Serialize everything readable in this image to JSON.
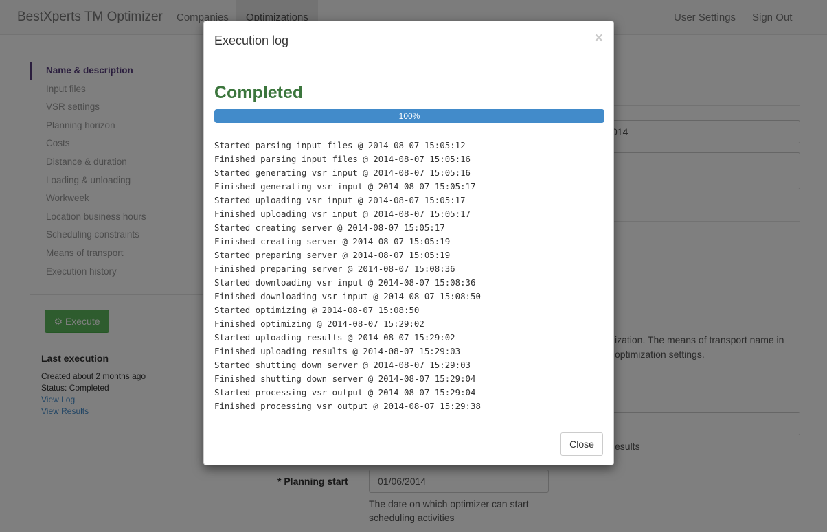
{
  "navbar": {
    "brand": "BestXperts TM Optimizer",
    "items": [
      {
        "label": "Companies"
      },
      {
        "label": "Optimizations"
      },
      {
        "label": "User Settings"
      },
      {
        "label": "Sign Out"
      }
    ]
  },
  "sidebar": {
    "items": [
      {
        "label": "Name & description"
      },
      {
        "label": "Input files"
      },
      {
        "label": "VSR settings"
      },
      {
        "label": "Planning horizon"
      },
      {
        "label": "Costs"
      },
      {
        "label": "Distance & duration"
      },
      {
        "label": "Loading & unloading"
      },
      {
        "label": "Workweek"
      },
      {
        "label": "Location business hours"
      },
      {
        "label": "Scheduling constraints"
      },
      {
        "label": "Means of transport"
      },
      {
        "label": "Execution history"
      }
    ],
    "execute_label": "Execute",
    "last_execution": {
      "heading": "Last execution",
      "created": "Created about 2 months ago",
      "status": "Status: Completed",
      "view_log": "View Log",
      "view_results": "View Results"
    }
  },
  "form": {
    "name_fragment": "014",
    "help_fragment_1": "ization. The means of transport name in",
    "help_fragment_2": "optimization settings.",
    "results_fragment": "esults",
    "planning_start_asterisk": "*",
    "planning_start_label": "Planning start",
    "planning_start_value": "01/06/2014",
    "planning_start_help_1": "The date on which optimizer can start",
    "planning_start_help_2": "scheduling activities"
  },
  "modal": {
    "title": "Execution log",
    "close_x": "×",
    "status": "Completed",
    "progress": 100,
    "progress_label": "100%",
    "log": [
      "Started parsing input files @ 2014-08-07 15:05:12",
      "Finished parsing input files @ 2014-08-07 15:05:16",
      "Started generating vsr input @ 2014-08-07 15:05:16",
      "Finished generating vsr input @ 2014-08-07 15:05:17",
      "Started uploading vsr input @ 2014-08-07 15:05:17",
      "Finished uploading vsr input @ 2014-08-07 15:05:17",
      "Started creating server @ 2014-08-07 15:05:17",
      "Finished creating server @ 2014-08-07 15:05:19",
      "Started preparing server @ 2014-08-07 15:05:19",
      "Finished preparing server @ 2014-08-07 15:08:36",
      "Started downloading vsr input @ 2014-08-07 15:08:36",
      "Finished downloading vsr input @ 2014-08-07 15:08:50",
      "Started optimizing @ 2014-08-07 15:08:50",
      "Finished optimizing @ 2014-08-07 15:29:02",
      "Started uploading results @ 2014-08-07 15:29:02",
      "Finished uploading results @ 2014-08-07 15:29:03",
      "Started shutting down server @ 2014-08-07 15:29:03",
      "Finished shutting down server @ 2014-08-07 15:29:04",
      "Started processing vsr output @ 2014-08-07 15:29:04",
      "Finished processing vsr output @ 2014-08-07 15:29:38"
    ],
    "close_label": "Close"
  },
  "colors": {
    "success": "#3c763d",
    "progress": "#428bca",
    "execute": "#5cb85c",
    "sidebar_active": "#563d7c"
  },
  "icons": {
    "execute": "gear-icon",
    "close": "close-icon"
  }
}
